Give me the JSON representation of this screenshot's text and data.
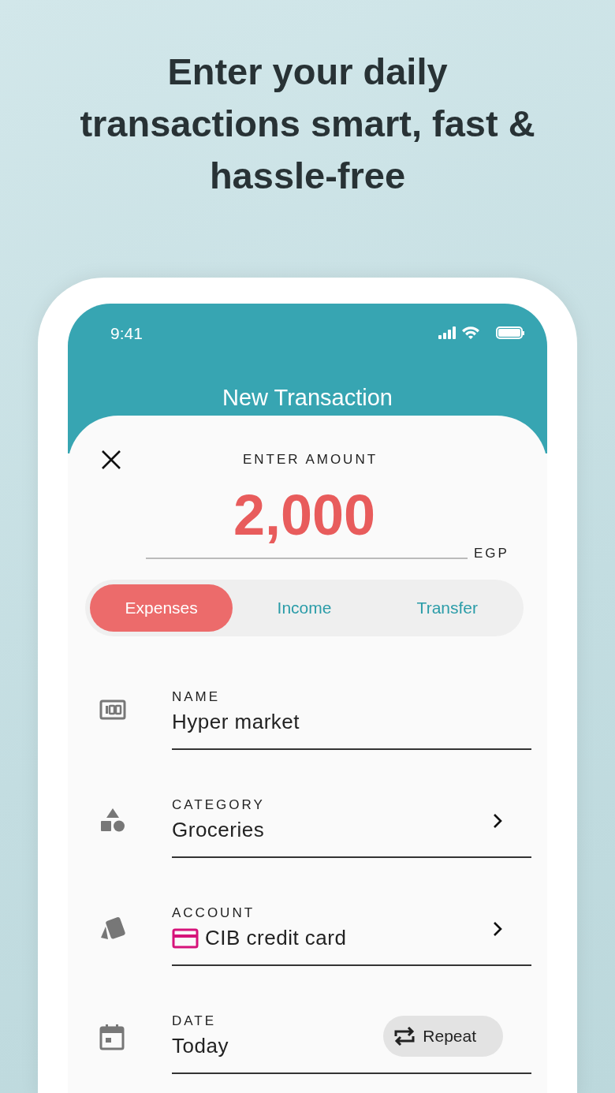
{
  "headline": "Enter your daily transactions smart, fast & hassle-free",
  "status_bar": {
    "time": "9:41"
  },
  "app_bar": {
    "title": "New Transaction"
  },
  "amount": {
    "label": "ENTER AMOUNT",
    "value": "2,000",
    "currency": "EGP"
  },
  "tabs": [
    {
      "label": "Expenses",
      "selected": true
    },
    {
      "label": "Income",
      "selected": false
    },
    {
      "label": "Transfer",
      "selected": false
    }
  ],
  "fields": [
    {
      "kind": "name",
      "label": "NAME",
      "value": "Hyper market"
    },
    {
      "kind": "category",
      "label": "CATEGORY",
      "value": "Groceries"
    },
    {
      "kind": "account",
      "label": "ACCOUNT",
      "value": "CIB credit card",
      "color": "#d6137a"
    },
    {
      "kind": "date",
      "label": "DATE",
      "value": "Today",
      "action": "Repeat"
    }
  ]
}
